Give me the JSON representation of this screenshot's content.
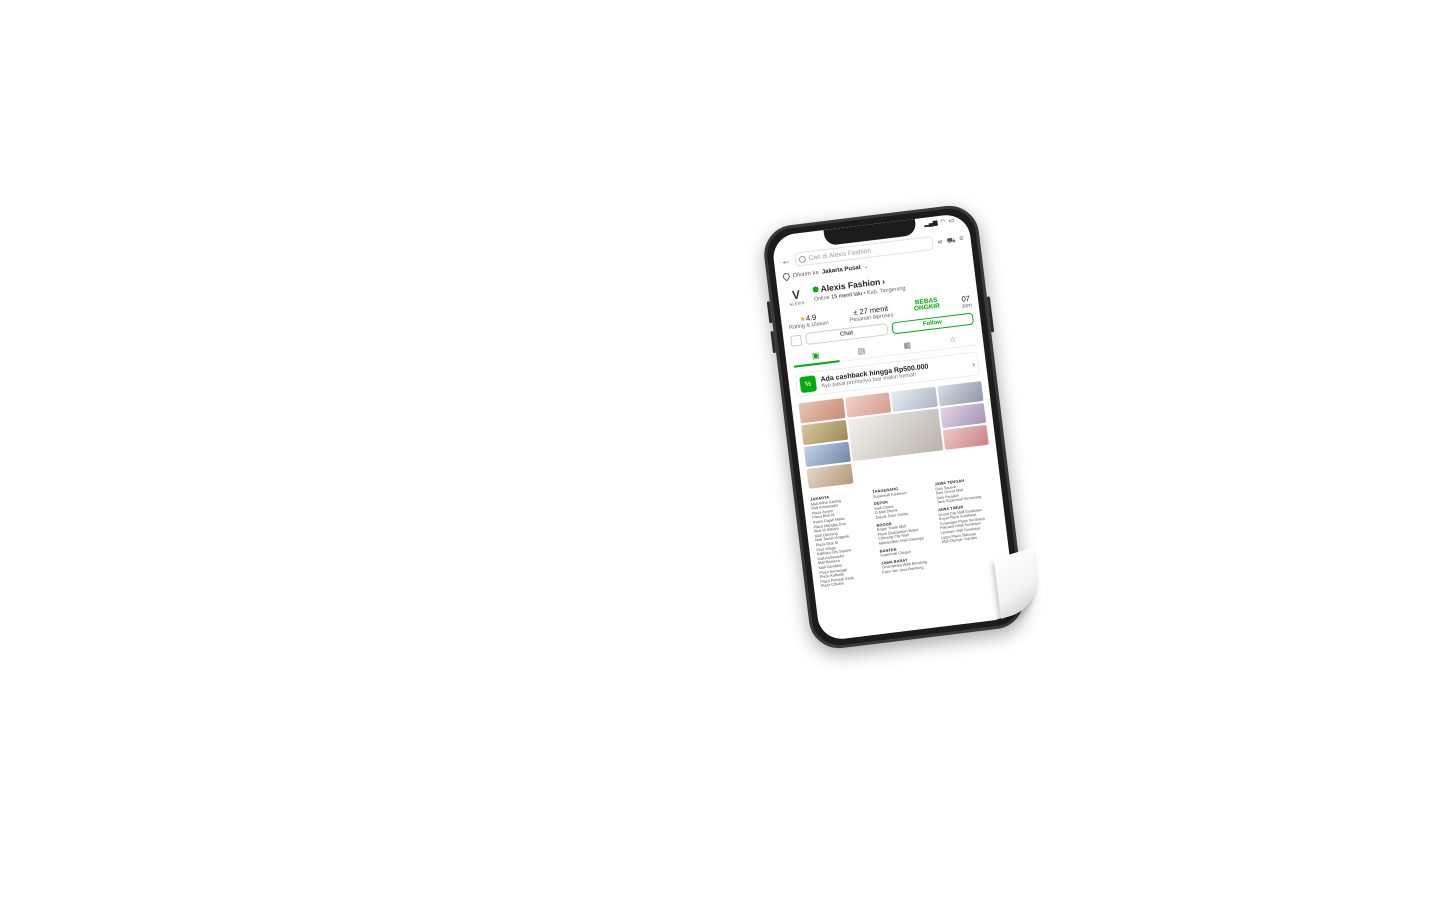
{
  "status_bar": {
    "signal": "▂▄▆",
    "wifi": "◠",
    "battery": "▭"
  },
  "search": {
    "placeholder": "Cari di Alexis Fashion"
  },
  "delivery": {
    "prefix": "Dikirim ke",
    "location": "Jakarta Pusat"
  },
  "shop": {
    "name": "Alexis Fashion",
    "brand_text": "ALEXIS",
    "status_online": "Online",
    "status_time": "15 menit lalu",
    "location": "Kab. Tangerang"
  },
  "stats": {
    "rating_value": "4.9",
    "rating_label": "Rating & Ulasan",
    "process_value": "± 27 menit",
    "process_label": "Pesanan diproses",
    "badge_line1": "BEBAS",
    "badge_line2": "ONGKIR",
    "extra_value": "07",
    "extra_label": "Jam"
  },
  "buttons": {
    "chat": "Chat",
    "follow": "Follow"
  },
  "promo": {
    "title": "Ada cashback hingga Rp500.000",
    "subtitle": "Ayo pakai promonya biar makin hemat!"
  },
  "stores": {
    "col1": {
      "region": "JAKARTA",
      "items": [
        "Mall Artha Gading",
        "Mall Ambasador",
        "Plaza Atrium",
        "Plaza Blok M",
        "Pasar Gajah Mada",
        "Plaza Mangga Dua",
        "Blok M Square",
        "Mall Cipinang",
        "Mall Taman Anggrek",
        "Plaza Blok M",
        "Pluit Village",
        "Kalibata City Square",
        "Mall Ambasador",
        "Mall Bassura",
        "Mall Gandaria",
        "Plaza Semanggi",
        "Plaza Kalibata",
        "Plaza Pondok Gede",
        "Plaza Cibubur"
      ]
    },
    "col2": {
      "region1": "TANGERANG",
      "items1": [
        "Supermall Karawaci"
      ],
      "region2": "DEPOK",
      "items2": [
        "Mall Cinere",
        "D Mall Depok",
        "Depok Town Center"
      ],
      "region3": "BOGOR",
      "items3": [
        "Bogor Trade Mall",
        "Plaza Ekalokasari Bogor",
        "Cibinong City Mall",
        "Metropolitan Mall Cileungsi"
      ],
      "region4": "BANTEN",
      "items4": [
        "Supermall Cilegon"
      ],
      "region5": "JAWA BARAT",
      "items5": [
        "Cihampelas Walk Bandung",
        "Paris Van Java Bandung"
      ]
    },
    "col3": {
      "region1": "JAWA TENGAH",
      "items1": [
        "Solo Square",
        "Solo Grand Mall",
        "Solo Paragon",
        "Java Supermall Semarang"
      ],
      "region2": "JAWA TIMUR",
      "items2": [
        "Grand City Mall Surabaya",
        "Royal Plaza Surabaya",
        "Tunjungan Plaza Surabaya",
        "Pakuwon Mall Surabaya",
        "Lenmarc Mall Surabaya",
        "Lippo Plaza Sidoarjo",
        "Mall Olympic Garden"
      ]
    }
  }
}
